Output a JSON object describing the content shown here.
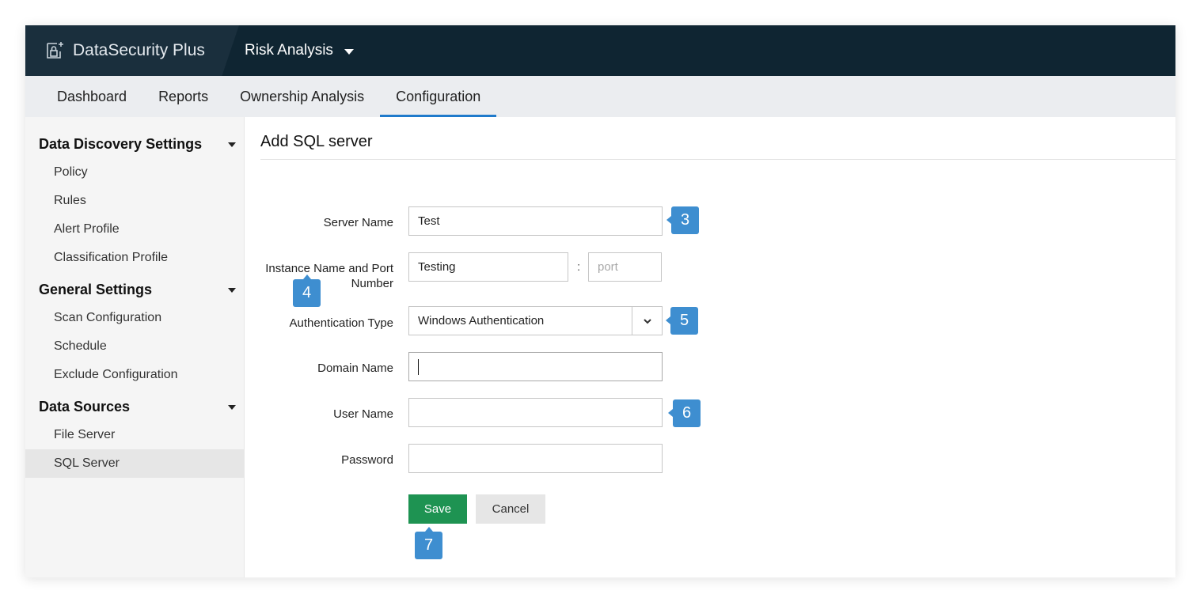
{
  "app": {
    "name": "DataSecurity Plus",
    "module": "Risk Analysis"
  },
  "tabs": [
    {
      "label": "Dashboard"
    },
    {
      "label": "Reports"
    },
    {
      "label": "Ownership Analysis"
    },
    {
      "label": "Configuration",
      "active": true
    }
  ],
  "sidebar": {
    "groups": [
      {
        "label": "Data Discovery Settings",
        "items": [
          "Policy",
          "Rules",
          "Alert Profile",
          "Classification Profile"
        ]
      },
      {
        "label": "General Settings",
        "items": [
          "Scan Configuration",
          "Schedule",
          "Exclude Configuration"
        ]
      },
      {
        "label": "Data Sources",
        "items": [
          "File Server",
          "SQL Server"
        ]
      }
    ],
    "active_item": "SQL Server"
  },
  "form": {
    "title": "Add SQL server",
    "server_name": {
      "label": "Server Name",
      "value": "Test"
    },
    "instance": {
      "label_line1": "Instance Name and Port",
      "label_line2": "Number",
      "value": "Testing",
      "separator": ":",
      "port_placeholder": "port"
    },
    "auth_type": {
      "label": "Authentication Type",
      "value": "Windows Authentication"
    },
    "domain_name": {
      "label": "Domain Name",
      "value": ""
    },
    "user_name": {
      "label": "User Name",
      "value": ""
    },
    "password": {
      "label": "Password",
      "value": ""
    },
    "save_label": "Save",
    "cancel_label": "Cancel"
  },
  "callouts": [
    "3",
    "4",
    "5",
    "6",
    "7"
  ],
  "colors": {
    "topbar": "#0f2532",
    "accent": "#1f7acb",
    "callout": "#3e8ed0",
    "save": "#1e9352"
  },
  "icons": {
    "brand": "lock-document-icon",
    "module_caret": "caret-down-icon",
    "select_caret": "chevron-down-icon"
  }
}
